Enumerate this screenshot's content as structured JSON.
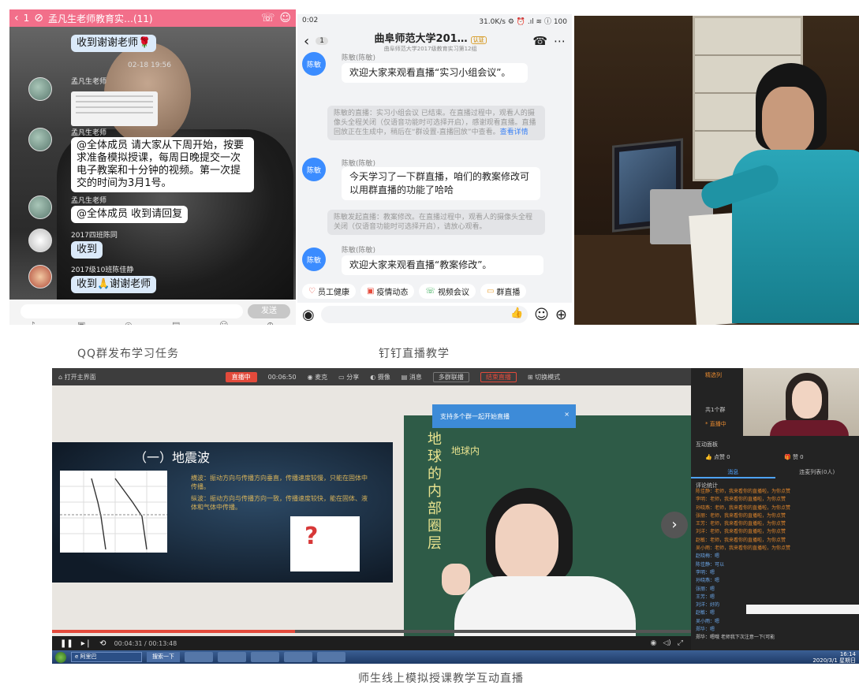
{
  "qq": {
    "header": {
      "back_count": "1",
      "title": "孟凡生老师教育实…(11)"
    },
    "messages": {
      "m1": "收到谢谢老师🌹",
      "time": "02-18 19:56",
      "sender_teacher": "孟凡生老师",
      "m2": "@全体成员 请大家从下周开始，按要求准备模拟授课，每周日晚提交一次电子教案和十分钟的视频。第一次提交的时间为3月1号。",
      "m3": "@全体成员 收到请回复",
      "sender_class": "2017四班陈同",
      "m4": "收到",
      "sender_other": "2017级10班陈佳静",
      "m5": "收到🙏谢谢老师"
    },
    "send_label": "发送"
  },
  "dingtalk": {
    "status_time": "0:02",
    "status_right": "31.0K/s ⚙ ⏰ .ıl ≋ ⓘ 100",
    "back_count": "1",
    "title": "曲阜师范大学201…",
    "title_tag": "认证",
    "subtitle": "曲阜师范大学2017级教育实习第12组",
    "avatar_name": "陈敏",
    "sender": "陈敏(陈敏)",
    "msg1": "欢迎大家来观看直播“实习小组会议”。",
    "sys1": "陈敏的直播：实习小组会议 已结束。在直播过程中，观看人的摄像头全程关闭（仅语音功能时可选择开启），感谢观看直播。直播回放正在生成中，稍后在“群设置-直播回放”中查看。",
    "sys1_link": "查看详情",
    "msg2": "今天学习了一下群直播，咱们的教案修改可以用群直播的功能了哈哈",
    "sys2": "陈敏发起直播：教案修改。在直播过程中，观看人的摄像头全程关闭（仅语音功能时可选择开启），请放心观看。",
    "msg3": "欢迎大家来观看直播“教案修改”。",
    "quick": [
      "员工健康",
      "疫情动态",
      "视频会议",
      "群直播"
    ]
  },
  "captions": {
    "qq": "QQ群发布学习任务",
    "dd": "钉钉直播教学",
    "live": "师生线上模拟授课教学互动直播"
  },
  "live": {
    "top": {
      "home": "⌂ 打开主界面",
      "onair": "直播中",
      "elapsed": "00:06:50",
      "mic": "◉ 麦克",
      "screen": "▭ 分享",
      "camera": "◐ 摄像",
      "comment": "▤ 消息",
      "multi": "多群联播",
      "end": "结束直播",
      "mode": "⊞ 切换模式"
    },
    "tip": "支持多个群一起开始直播",
    "slide_title": "（一）地震波",
    "slide_text1": "横波：振动方向与传播方向垂直，传播速度较慢，只能在固体中传播。",
    "slide_text2": "纵波：振动方向与传播方向一致，传播速度较快，能在固体、液体和气体中传播。",
    "chalk": "地球的内部圈层",
    "chalk2": "地球内",
    "progress": 0.38,
    "time_now": "00:04:31",
    "time_total": "00:13:48",
    "taskbar_ie": "e 阿里巴",
    "taskbar_search": "搜索一下",
    "clock_time": "16:14",
    "clock_date": "2020/3/1 星期日",
    "side": {
      "tab_label": "精选列",
      "count": "共1个群",
      "live_tag": "* 直播中",
      "interact": "互动面板",
      "like": "👍 点赞 0",
      "gift": "🎁 赞 0",
      "tab1": "消息",
      "tab2": "连麦列表(0人)",
      "comment_title": "评论统计",
      "comments": [
        {
          "c": "o",
          "t": "陈佳静：老师，我来看你的直播啦，为你点赞"
        },
        {
          "c": "o",
          "t": "李明：老师，我来看你的直播啦，为你点赞"
        },
        {
          "c": "o",
          "t": "孙晓燕：老师，我来看你的直播啦，为你点赞"
        },
        {
          "c": "o",
          "t": "张丽：老师，我来看你的直播啦，为你点赞"
        },
        {
          "c": "o",
          "t": "王芳：老师，我来看你的直播啦，为你点赞"
        },
        {
          "c": "o",
          "t": "刘洋：老师，我来看你的直播啦，为你点赞"
        },
        {
          "c": "o",
          "t": "赵敏：老师，我来看你的直播啦，为你点赞"
        },
        {
          "c": "o",
          "t": "吴小雨：老师，我来看你的直播啦，为你点赞"
        },
        {
          "c": "b",
          "t": "赵晓梅：嗯"
        },
        {
          "c": "b",
          "t": "陈佳静：可以"
        },
        {
          "c": "b",
          "t": "李明：嗯"
        },
        {
          "c": "b",
          "t": "孙晓燕：嗯"
        },
        {
          "c": "b",
          "t": "张丽：嗯"
        },
        {
          "c": "b",
          "t": "王芳：嗯"
        },
        {
          "c": "b",
          "t": "刘洋：好的"
        },
        {
          "c": "b",
          "t": "赵敏：嗯"
        },
        {
          "c": "b",
          "t": "吴小雨：嗯"
        },
        {
          "c": "b",
          "t": "郑华：嗯"
        },
        {
          "c": "w",
          "t": "郑华：嗯哦 老师我下次注意一下(可能"
        }
      ]
    }
  }
}
